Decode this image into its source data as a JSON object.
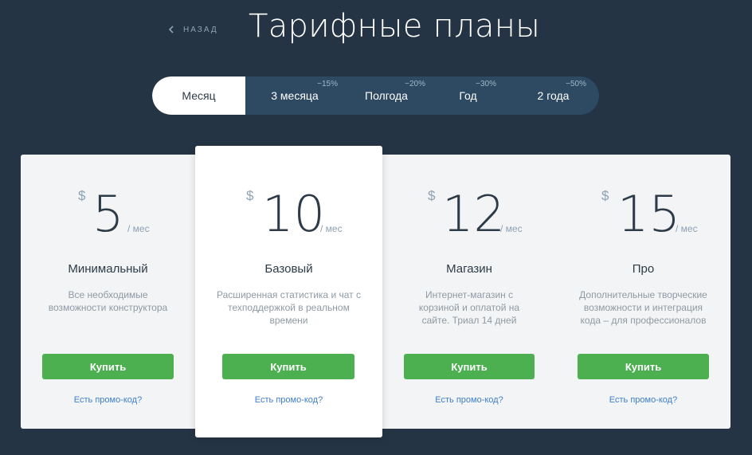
{
  "header": {
    "back_label": "НАЗАД",
    "title": "Тарифные планы"
  },
  "periods": [
    {
      "label": "Месяц",
      "discount": ""
    },
    {
      "label": "3 месяца",
      "discount": "−15%"
    },
    {
      "label": "Полгода",
      "discount": "−20%"
    },
    {
      "label": "Год",
      "discount": "−30%"
    },
    {
      "label": "2 года",
      "discount": "−50%"
    }
  ],
  "plans": [
    {
      "currency": "$",
      "price": "5",
      "per": "/ мес",
      "name": "Минимальный",
      "description": "Все необходимые возможности конструктора",
      "buy_label": "Купить",
      "promo_label": "Есть промо-код?"
    },
    {
      "currency": "$",
      "price": "10",
      "per": "/ мес",
      "name": "Базовый",
      "description": "Расширенная статистика и чат с техподдержкой в реальном времени",
      "buy_label": "Купить",
      "promo_label": "Есть промо-код?"
    },
    {
      "currency": "$",
      "price": "12",
      "per": "/ мес",
      "name": "Магазин",
      "description": "Интернет-магазин с корзиной и оплатой на сайте. Триал 14 дней",
      "buy_label": "Купить",
      "promo_label": "Есть промо-код?"
    },
    {
      "currency": "$",
      "price": "15",
      "per": "/ мес",
      "name": "Про",
      "description": "Дополнительные творческие возможности и интеграция кода – для профессионалов",
      "buy_label": "Купить",
      "promo_label": "Есть промо-код?"
    }
  ],
  "colors": {
    "background": "#253444",
    "switcher": "#2e4a62",
    "buy_button": "#4caf50",
    "promo_link": "#3f7fc9"
  }
}
